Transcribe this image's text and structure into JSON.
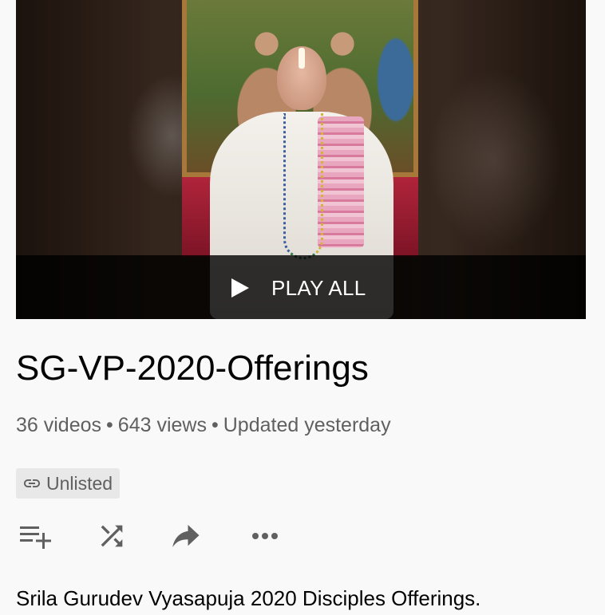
{
  "playlist": {
    "title": "SG-VP-2020-Offerings",
    "play_all_label": "PLAY ALL",
    "stats": {
      "videos": "36 videos",
      "views": "643 views",
      "updated": "Updated yesterday",
      "separator": "•"
    },
    "privacy_badge": {
      "icon": "link-icon",
      "label": "Unlisted"
    },
    "actions": [
      {
        "name": "save-to-playlist",
        "icon": "playlist-add-icon"
      },
      {
        "name": "shuffle",
        "icon": "shuffle-icon"
      },
      {
        "name": "share",
        "icon": "share-icon"
      },
      {
        "name": "more",
        "icon": "more-horizontal-icon"
      }
    ],
    "description": "Srila Gurudev Vyasapuja 2020 Disciples Offerings."
  },
  "colors": {
    "background": "#f9f9f9",
    "title_text": "#030303",
    "secondary_text": "#606060",
    "badge_background": "#e8e8e8",
    "overlay": "#000000cc"
  }
}
